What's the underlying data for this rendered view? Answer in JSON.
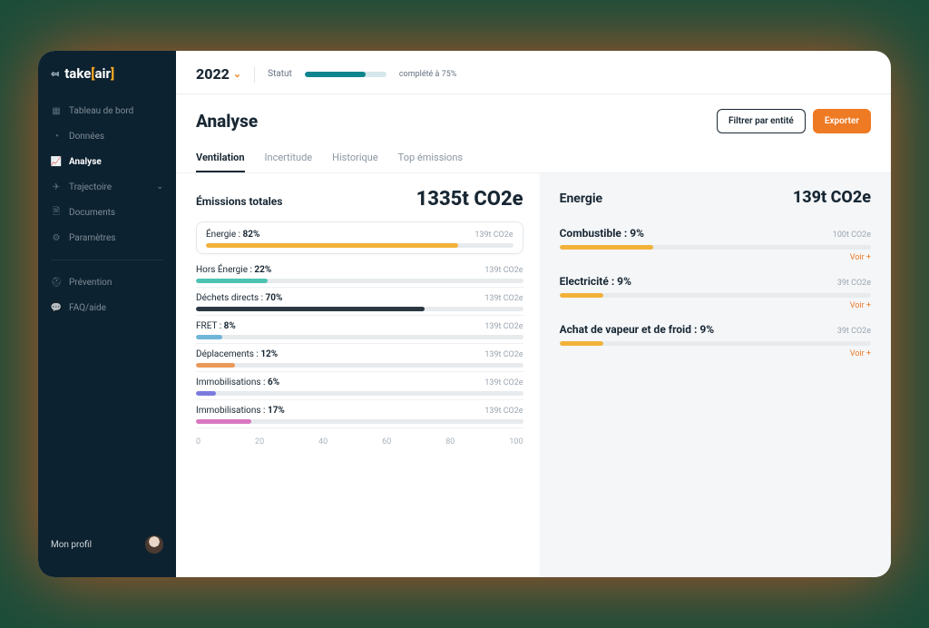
{
  "logo": {
    "pre": "take",
    "bo": "[",
    "mid": "air",
    "bc": "]"
  },
  "sidebar": {
    "items": [
      {
        "label": "Tableau de bord"
      },
      {
        "label": "Données"
      },
      {
        "label": "Analyse"
      },
      {
        "label": "Trajectoire"
      },
      {
        "label": "Documents"
      },
      {
        "label": "Paramètres"
      },
      {
        "label": "Prévention"
      },
      {
        "label": "FAQ/aide"
      }
    ],
    "profile": "Mon profil"
  },
  "topbar": {
    "year": "2022",
    "status_label": "Statut",
    "status_text": "complété à 75%",
    "status_percent": 75
  },
  "page": {
    "title": "Analyse",
    "filter_btn": "Filtrer par entité",
    "export_btn": "Exporter"
  },
  "tabs": [
    {
      "label": "Ventilation"
    },
    {
      "label": "Incertitude"
    },
    {
      "label": "Historique"
    },
    {
      "label": "Top émissions"
    }
  ],
  "left": {
    "title": "Émissions totales",
    "total": "1335t CO2e",
    "rows": [
      {
        "name": "Énergie",
        "pct": "82%",
        "val": "139t CO2e",
        "width": 82,
        "color": "#f2b23a"
      },
      {
        "name": "Hors Énergie",
        "pct": "22%",
        "val": "139t CO2e",
        "width": 22,
        "color": "#4fc3b3"
      },
      {
        "name": "Déchets directs",
        "pct": "70%",
        "val": "139t CO2e",
        "width": 70,
        "color": "#2b3640"
      },
      {
        "name": "FRET",
        "pct": "8%",
        "val": "139t CO2e",
        "width": 8,
        "color": "#6fb5d9"
      },
      {
        "name": "Déplacements",
        "pct": "12%",
        "val": "139t CO2e",
        "width": 12,
        "color": "#e99a5b"
      },
      {
        "name": "Immobilisations",
        "pct": "6%",
        "val": "139t CO2e",
        "width": 6,
        "color": "#7b7bde"
      },
      {
        "name": "Immobilisations",
        "pct": "17%",
        "val": "139t CO2e",
        "width": 17,
        "color": "#d876c0"
      }
    ],
    "axis": [
      "0",
      "20",
      "40",
      "60",
      "80",
      "100"
    ]
  },
  "right": {
    "title": "Energie",
    "total": "139t CO2e",
    "voir": "Voir +",
    "items": [
      {
        "name": "Combustible",
        "pct": "9%",
        "val": "100t CO2e",
        "width": 30
      },
      {
        "name": "Electricité",
        "pct": "9%",
        "val": "39t CO2e",
        "width": 14
      },
      {
        "name": "Achat de vapeur et de froid",
        "pct": "9%",
        "val": "39t CO2e",
        "width": 14
      }
    ]
  },
  "chart_data": {
    "type": "bar",
    "title": "Émissions totales",
    "total_value": 1335,
    "unit": "t CO2e",
    "xlabel": "",
    "ylabel": "%",
    "xlim": [
      0,
      100
    ],
    "categories": [
      "Énergie",
      "Hors Énergie",
      "Déchets directs",
      "FRET",
      "Déplacements",
      "Immobilisations",
      "Immobilisations"
    ],
    "values": [
      82,
      22,
      70,
      8,
      12,
      6,
      17
    ],
    "value_labels": [
      "139t CO2e",
      "139t CO2e",
      "139t CO2e",
      "139t CO2e",
      "139t CO2e",
      "139t CO2e",
      "139t CO2e"
    ],
    "detail_panel": {
      "title": "Energie",
      "total": "139t CO2e",
      "series": [
        {
          "name": "Combustible",
          "pct": 9,
          "value_label": "100t CO2e"
        },
        {
          "name": "Electricité",
          "pct": 9,
          "value_label": "39t CO2e"
        },
        {
          "name": "Achat de vapeur et de froid",
          "pct": 9,
          "value_label": "39t CO2e"
        }
      ]
    }
  }
}
